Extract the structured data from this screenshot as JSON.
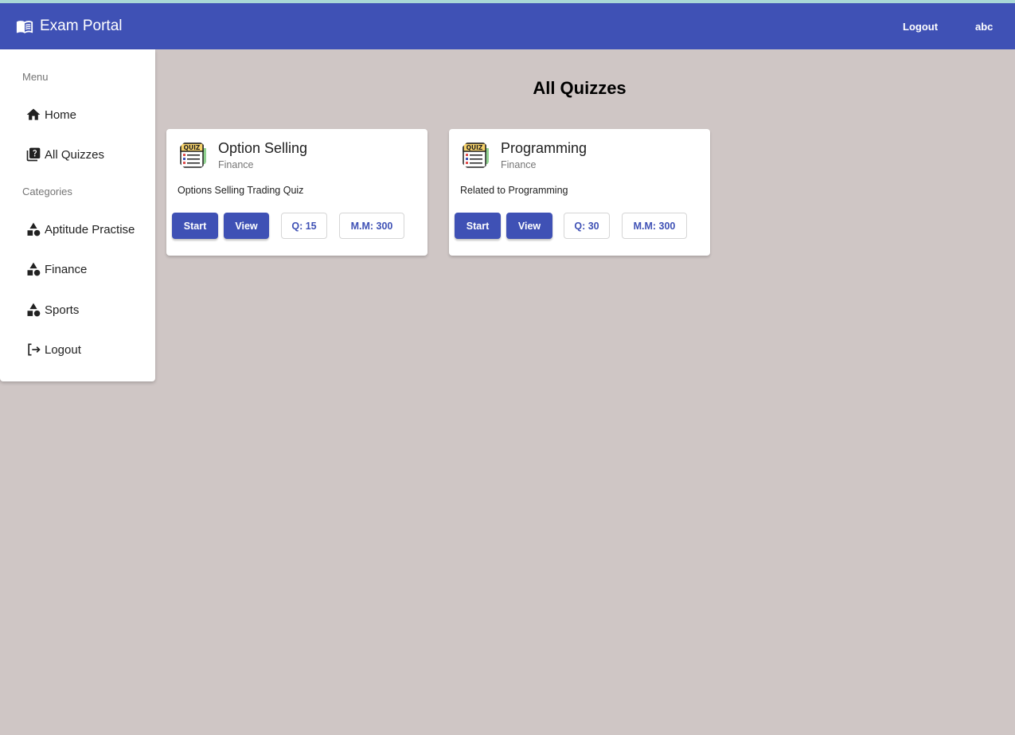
{
  "toolbar": {
    "title": "Exam Portal",
    "logout_label": "Logout",
    "user_label": "abc"
  },
  "sidebar": {
    "menu_header": "Menu",
    "menu_items": [
      {
        "label": "Home",
        "icon": "home-icon"
      },
      {
        "label": "All Quizzes",
        "icon": "quiz-icon"
      }
    ],
    "categories_header": "Categories",
    "category_items": [
      {
        "label": "Aptitude Practise",
        "icon": "category-icon"
      },
      {
        "label": "Finance",
        "icon": "category-icon"
      },
      {
        "label": "Sports",
        "icon": "category-icon"
      }
    ],
    "logout_item": {
      "label": "Logout",
      "icon": "logout-icon"
    }
  },
  "main": {
    "title": "All Quizzes",
    "quizzes": [
      {
        "title": "Option Selling",
        "category": "Finance",
        "description": "Options Selling Trading Quiz",
        "start_label": "Start",
        "view_label": "View",
        "questions_label": "Q: 15",
        "max_marks_label": "M.M: 300"
      },
      {
        "title": "Programming",
        "category": "Finance",
        "description": "Related to Programming",
        "start_label": "Start",
        "view_label": "View",
        "questions_label": "Q: 30",
        "max_marks_label": "M.M: 300"
      }
    ]
  },
  "colors": {
    "primary": "#3f51b5",
    "background": "#cfc6c5"
  }
}
